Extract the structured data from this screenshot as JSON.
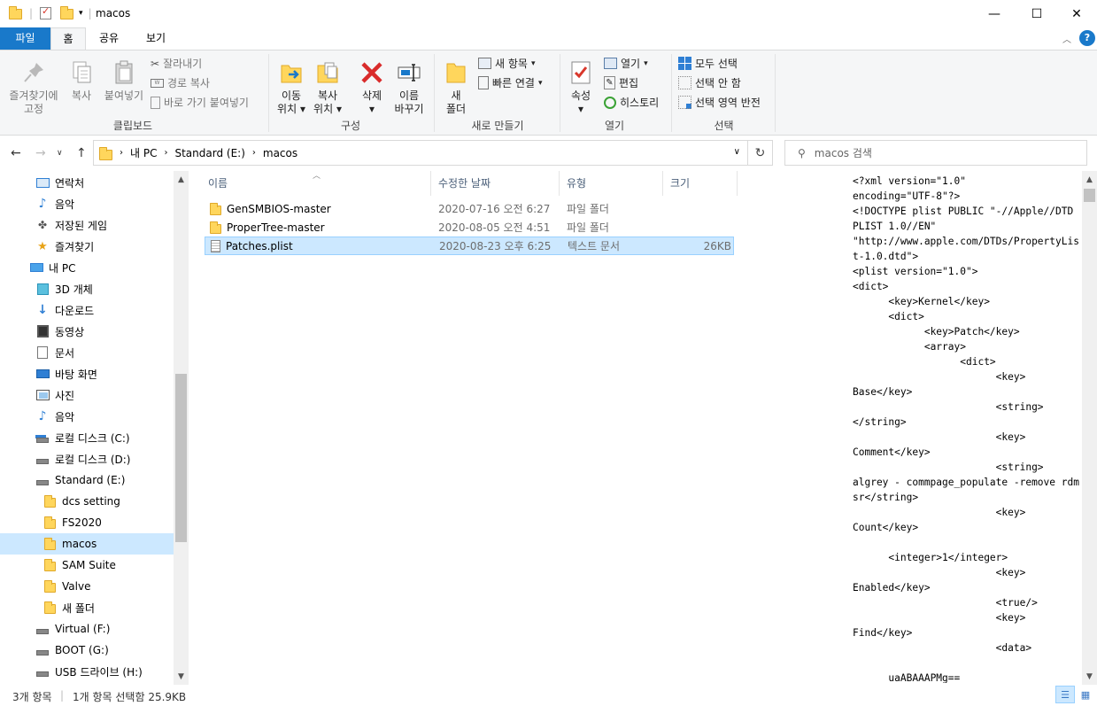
{
  "window": {
    "title": "macos",
    "minimize_glyph": "—",
    "maximize_glyph": "☐",
    "close_glyph": "✕"
  },
  "tabs": {
    "file": "파일",
    "home": "홈",
    "share": "공유",
    "view": "보기"
  },
  "ribbon": {
    "clipboard": {
      "title": "클립보드",
      "pin_line1": "즐겨찾기에",
      "pin_line2": "고정",
      "copy": "복사",
      "paste": "붙여넣기",
      "cut": "잘라내기",
      "copy_path": "경로 복사",
      "paste_shortcut": "바로 가기 붙여넣기"
    },
    "organize": {
      "title": "구성",
      "move_line1": "이동",
      "move_line2": "위치",
      "copy_line1": "복사",
      "copy_line2": "위치",
      "delete": "삭제",
      "rename_line1": "이름",
      "rename_line2": "바꾸기"
    },
    "new": {
      "title": "새로 만들기",
      "folder_line1": "새",
      "folder_line2": "폴더",
      "new_item": "새 항목",
      "easy_access": "빠른 연결"
    },
    "open": {
      "title": "열기",
      "properties": "속성",
      "open": "열기",
      "edit": "편집",
      "history": "히스토리"
    },
    "select": {
      "title": "선택",
      "select_all": "모두 선택",
      "select_none": "선택 안 함",
      "invert": "선택 영역 반전"
    }
  },
  "address": {
    "crumbs": [
      "내 PC",
      "Standard (E:)",
      "macos"
    ],
    "search_placeholder": "macos 검색"
  },
  "nav": {
    "items": [
      {
        "label": "연락처",
        "icon": "contacts-icon",
        "indent": 40
      },
      {
        "label": "음악",
        "icon": "music-icon",
        "indent": 40
      },
      {
        "label": "저장된 게임",
        "icon": "saved-games-icon",
        "indent": 40
      },
      {
        "label": "즐겨찾기",
        "icon": "favorites-icon",
        "indent": 40
      },
      {
        "label": "내 PC",
        "icon": "this-pc-icon",
        "indent": 33
      },
      {
        "label": "3D 개체",
        "icon": "3d-objects-icon",
        "indent": 40
      },
      {
        "label": "다운로드",
        "icon": "downloads-icon",
        "indent": 40
      },
      {
        "label": "동영상",
        "icon": "videos-icon",
        "indent": 40
      },
      {
        "label": "문서",
        "icon": "documents-icon",
        "indent": 40
      },
      {
        "label": "바탕 화면",
        "icon": "desktop-icon",
        "indent": 40
      },
      {
        "label": "사진",
        "icon": "pictures-icon",
        "indent": 40
      },
      {
        "label": "음악",
        "icon": "music-icon",
        "indent": 40
      },
      {
        "label": "로컬 디스크 (C:)",
        "icon": "system-drive-icon",
        "indent": 40
      },
      {
        "label": "로컬 디스크 (D:)",
        "icon": "drive-icon",
        "indent": 40
      },
      {
        "label": "Standard (E:)",
        "icon": "drive-icon",
        "indent": 40
      },
      {
        "label": "dcs setting",
        "icon": "folder-icon",
        "indent": 48
      },
      {
        "label": "FS2020",
        "icon": "folder-icon",
        "indent": 48
      },
      {
        "label": "macos",
        "icon": "folder-icon",
        "indent": 48
      },
      {
        "label": "SAM Suite",
        "icon": "folder-icon",
        "indent": 48
      },
      {
        "label": "Valve",
        "icon": "folder-icon",
        "indent": 48
      },
      {
        "label": "새 폴더",
        "icon": "folder-icon",
        "indent": 48
      },
      {
        "label": "Virtual (F:)",
        "icon": "drive-icon",
        "indent": 40
      },
      {
        "label": "BOOT (G:)",
        "icon": "drive-icon",
        "indent": 40
      },
      {
        "label": "USB 드라이브 (H:)",
        "icon": "drive-icon",
        "indent": 40
      }
    ],
    "selected_index": 17
  },
  "files": {
    "headers": {
      "name": "이름",
      "date": "수정한 날짜",
      "type": "유형",
      "size": "크기"
    },
    "rows": [
      {
        "name": "GenSMBIOS-master",
        "date": "2020-07-16 오전 6:27",
        "type": "파일 폴더",
        "size": "",
        "kind": "folder"
      },
      {
        "name": "ProperTree-master",
        "date": "2020-08-05 오전 4:51",
        "type": "파일 폴더",
        "size": "",
        "kind": "folder"
      },
      {
        "name": "Patches.plist",
        "date": "2020-08-23 오후 6:25",
        "type": "텍스트 문서",
        "size": "26KB",
        "kind": "file"
      }
    ],
    "selected_index": 2
  },
  "preview": {
    "text": "<?xml version=\"1.0\"\nencoding=\"UTF-8\"?>\n<!DOCTYPE plist PUBLIC \"-//Apple//DTD PLIST 1.0//EN\"\n\"http://www.apple.com/DTDs/PropertyList-1.0.dtd\">\n<plist version=\"1.0\">\n<dict>\n\t<key>Kernel</key>\n\t<dict>\n\t\t<key>Patch</key>\n\t\t<array>\n\t\t\t<dict>\n\t\t\t\t<key>\nBase</key>\n\t\t\t\t<string>\n</string>\n\t\t\t\t<key>\nComment</key>\n\t\t\t\t<string>\nalgrey - commpage_populate -remove rdmsr</string>\n\t\t\t\t<key>\nCount</key>\n\n\t<integer>1</integer>\n\t\t\t\t<key>\nEnabled</key>\n\t\t\t\t<true/>\n\t\t\t\t<key>\nFind</key>\n\t\t\t\t<data>\n\n\tuaABAAAPMg=="
  },
  "status": {
    "count": "3개 항목",
    "selection": "1개 항목 선택함 25.9KB"
  }
}
